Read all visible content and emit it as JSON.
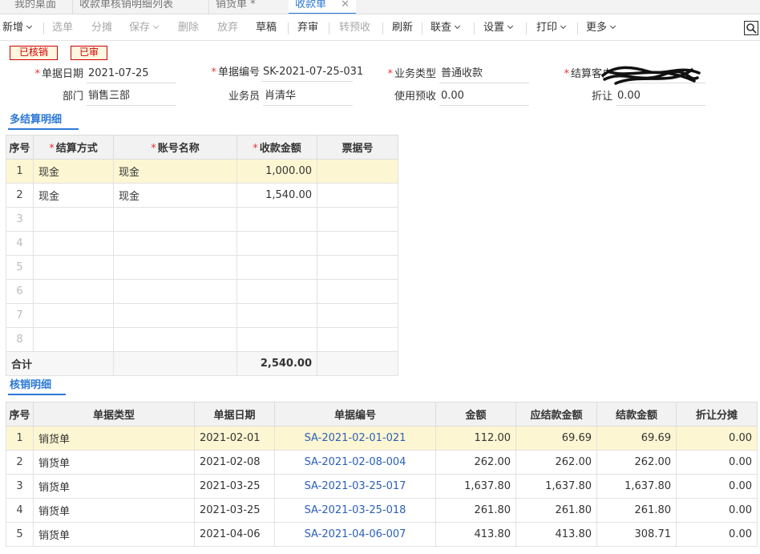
{
  "tabs": [
    {
      "label": "我的桌面"
    },
    {
      "label": "收款单核销明细列表"
    },
    {
      "label": "销货单 *"
    },
    {
      "label": "收款单",
      "close": "✕"
    }
  ],
  "toolbar": {
    "new": "新增",
    "select_doc": "选单",
    "share": "分摊",
    "save": "保存",
    "delete": "删除",
    "abandon": "放弃",
    "draft": "草稿",
    "discard_audit": "弃审",
    "to_prepay": "转预收",
    "refresh": "刷新",
    "linked_query": "联查",
    "settings": "设置",
    "print": "打印",
    "more": "更多"
  },
  "badges": {
    "verified": "已核销",
    "audited": "已审"
  },
  "form": {
    "doc_date_label": "单据日期",
    "doc_date": "2021-07-25",
    "doc_no_label": "单据编号",
    "doc_no": "SK-2021-07-25-031",
    "biz_type_label": "业务类型",
    "biz_type": "普通收款",
    "settle_customer_label": "结算客户",
    "department_label": "部门",
    "department": "销售三部",
    "salesman_label": "业务员",
    "salesman": "肖清华",
    "use_prepay_label": "使用预收",
    "use_prepay": "0.00",
    "discount_label": "折让",
    "discount": "0.00"
  },
  "settle_section": {
    "title": "多结算明细"
  },
  "settle_table": {
    "headers": [
      "序号",
      "结算方式",
      "账号名称",
      "收款金额",
      "票据号"
    ],
    "rows": [
      {
        "no": "1",
        "method": "现金",
        "account": "现金",
        "amount": "1,000.00",
        "bill": ""
      },
      {
        "no": "2",
        "method": "现金",
        "account": "现金",
        "amount": "1,540.00",
        "bill": ""
      },
      {
        "no": "3",
        "method": "",
        "account": "",
        "amount": "",
        "bill": ""
      },
      {
        "no": "4",
        "method": "",
        "account": "",
        "amount": "",
        "bill": ""
      },
      {
        "no": "5",
        "method": "",
        "account": "",
        "amount": "",
        "bill": ""
      },
      {
        "no": "6",
        "method": "",
        "account": "",
        "amount": "",
        "bill": ""
      },
      {
        "no": "7",
        "method": "",
        "account": "",
        "amount": "",
        "bill": ""
      },
      {
        "no": "8",
        "method": "",
        "account": "",
        "amount": "",
        "bill": ""
      }
    ],
    "total_label": "合计",
    "total_amount": "2,540.00"
  },
  "verify_section": {
    "title": "核销明细"
  },
  "verify_table": {
    "headers": [
      "序号",
      "单据类型",
      "单据日期",
      "单据编号",
      "金额",
      "应结款金额",
      "结款金额",
      "折让分摊"
    ],
    "rows": [
      {
        "no": "1",
        "type": "销货单",
        "date": "2021-02-01",
        "doc": "SA-2021-02-01-021",
        "amount": "112.00",
        "due": "69.69",
        "paid": "69.69",
        "disc": "0.00"
      },
      {
        "no": "2",
        "type": "销货单",
        "date": "2021-02-08",
        "doc": "SA-2021-02-08-004",
        "amount": "262.00",
        "due": "262.00",
        "paid": "262.00",
        "disc": "0.00"
      },
      {
        "no": "3",
        "type": "销货单",
        "date": "2021-03-25",
        "doc": "SA-2021-03-25-017",
        "amount": "1,637.80",
        "due": "1,637.80",
        "paid": "1,637.80",
        "disc": "0.00"
      },
      {
        "no": "4",
        "type": "销货单",
        "date": "2021-03-25",
        "doc": "SA-2021-03-25-018",
        "amount": "261.80",
        "due": "261.80",
        "paid": "261.80",
        "disc": "0.00"
      },
      {
        "no": "5",
        "type": "销货单",
        "date": "2021-04-06",
        "doc": "SA-2021-04-06-007",
        "amount": "413.80",
        "due": "413.80",
        "paid": "308.71",
        "disc": "0.00"
      }
    ]
  }
}
